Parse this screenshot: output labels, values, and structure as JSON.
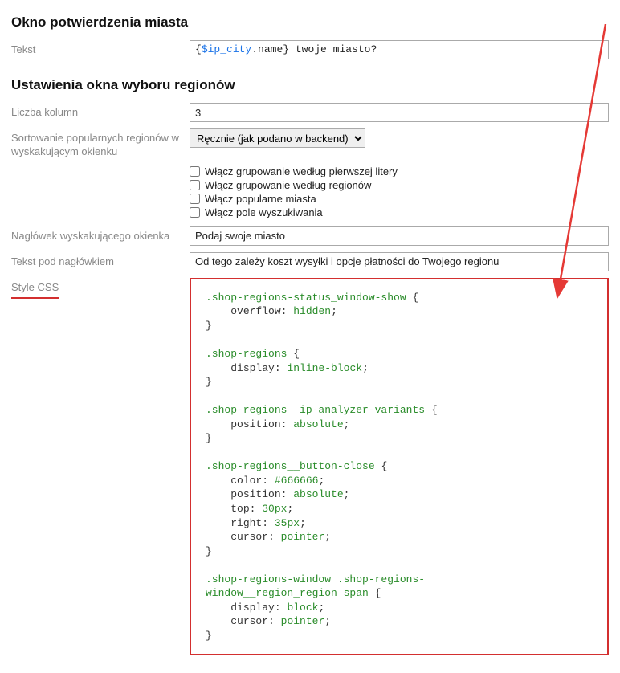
{
  "section1": {
    "title": "Okno potwierdzenia miasta",
    "text_label": "Tekst",
    "text_value_pre": "{",
    "text_value_var": "$ip_city",
    "text_value_post": ".name} twoje miasto?"
  },
  "section2": {
    "title": "Ustawienia okna wyboru regionów",
    "cols_label": "Liczba kolumn",
    "cols_value": "3",
    "sort_label": "Sortowanie popularnych regionów w wyskakującym okienku",
    "sort_value": "Ręcznie (jak podano w backend)",
    "checkboxes": [
      "Włącz grupowanie według pierwszej litery",
      "Włącz grupowanie według regionów",
      "Włącz popularne miasta",
      "Włącz pole wyszukiwania"
    ],
    "popup_header_label": "Nagłówek wyskakującego okienka",
    "popup_header_value": "Podaj swoje miasto",
    "popup_subtext_label": "Tekst pod nagłówkiem",
    "popup_subtext_value": "Od tego zależy koszt wysyłki i opcje płatności do Twojego regionu",
    "style_css_label": "Style CSS"
  },
  "css_code": {
    "r1_sel": ".shop-regions-status_window-show",
    "r1_p1": "overflow",
    "r1_v1": "hidden",
    "r2_sel": ".shop-regions",
    "r2_p1": "display",
    "r2_v1": "inline-block",
    "r3_sel": ".shop-regions__ip-analyzer-variants",
    "r3_p1": "position",
    "r3_v1": "absolute",
    "r4_sel": ".shop-regions__button-close",
    "r4_p1": "color",
    "r4_v1": "#666666",
    "r4_p2": "position",
    "r4_v2": "absolute",
    "r4_p3": "top",
    "r4_v3": "30px",
    "r4_p4": "right",
    "r4_v4": "35px",
    "r4_p5": "cursor",
    "r4_v5": "pointer",
    "r5_sel_a": ".shop-regions-window .shop-regions-",
    "r5_sel_b": "window__region_region span",
    "r5_p1": "display",
    "r5_v1": "block",
    "r5_p2": "cursor",
    "r5_v2": "pointer"
  }
}
